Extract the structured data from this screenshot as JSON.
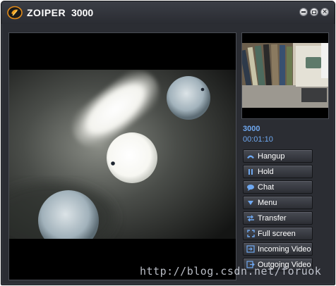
{
  "titlebar": {
    "app_name": "ZOIPER",
    "account_number": "3000",
    "logo_icon": "zoiper-logo-icon",
    "controls": [
      "minimize-icon",
      "maximize-icon",
      "close-icon"
    ]
  },
  "call": {
    "caller": "3000",
    "duration": "00:01:10"
  },
  "buttons": [
    {
      "label": "Hangup",
      "icon": "hangup-icon"
    },
    {
      "label": "Hold",
      "icon": "pause-icon"
    },
    {
      "label": "Chat",
      "icon": "chat-bubble-icon"
    },
    {
      "label": "Menu",
      "icon": "triangle-down-icon"
    },
    {
      "label": "Transfer",
      "icon": "transfer-arrows-icon"
    },
    {
      "label": "Full screen",
      "icon": "fullscreen-icon"
    },
    {
      "label": "Incoming Video",
      "icon": "incoming-video-icon"
    },
    {
      "label": "Outgoing Video",
      "icon": "outgoing-video-icon"
    }
  ],
  "watermark": "http://blog.csdn.net/foruok",
  "colors": {
    "window_bg": "#2b2d33",
    "accent_text": "#6fa8f0",
    "button_bg": "#3a3d44"
  }
}
